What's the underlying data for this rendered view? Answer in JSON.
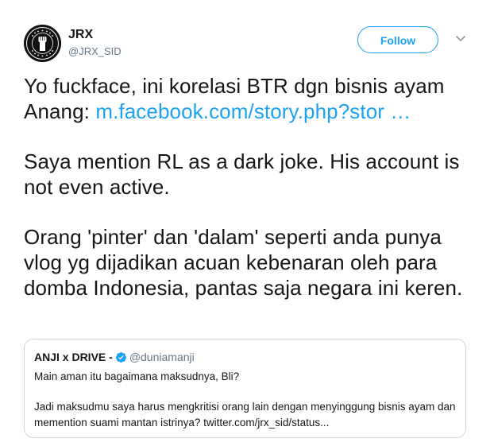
{
  "author": {
    "display_name": "JRX",
    "handle": "@JRX_SID",
    "avatar_icon": "fist-emblem-icon",
    "avatar_text_top": "TOLAK REKLAMASI",
    "avatar_text_bottom": "TELUK BENOA"
  },
  "actions": {
    "follow_label": "Follow",
    "menu_icon": "chevron-down-icon"
  },
  "tweet": {
    "line1_prefix": "Yo fuckface, ini korelasi BTR dgn bisnis ayam Anang: ",
    "line1_link": "m.facebook.com/story.php?stor",
    "line1_ellipsis": " …",
    "para2": "Saya mention RL as a dark joke. His account is not even active.",
    "para3": "Orang 'pinter' dan 'dalam' seperti anda punya vlog yg dijadikan acuan kebenaran oleh para domba Indonesia, pantas saja negara ini keren."
  },
  "quoted_tweet": {
    "display_name": "ANJI x DRIVE -",
    "verified_icon": "verified-badge-icon",
    "handle": "@duniamanji",
    "para1": "Main aman itu bagaimana maksudnya, Bli?",
    "para2": "Jadi maksudmu saya harus mengkritisi orang lain dengan menyinggung bisnis ayam dan memention suami mantan istrinya? twitter.com/jrx_sid/status..."
  },
  "colors": {
    "accent": "#1da1f2",
    "text": "#14171a",
    "secondary": "#657786",
    "border": "#ccd6dd"
  }
}
